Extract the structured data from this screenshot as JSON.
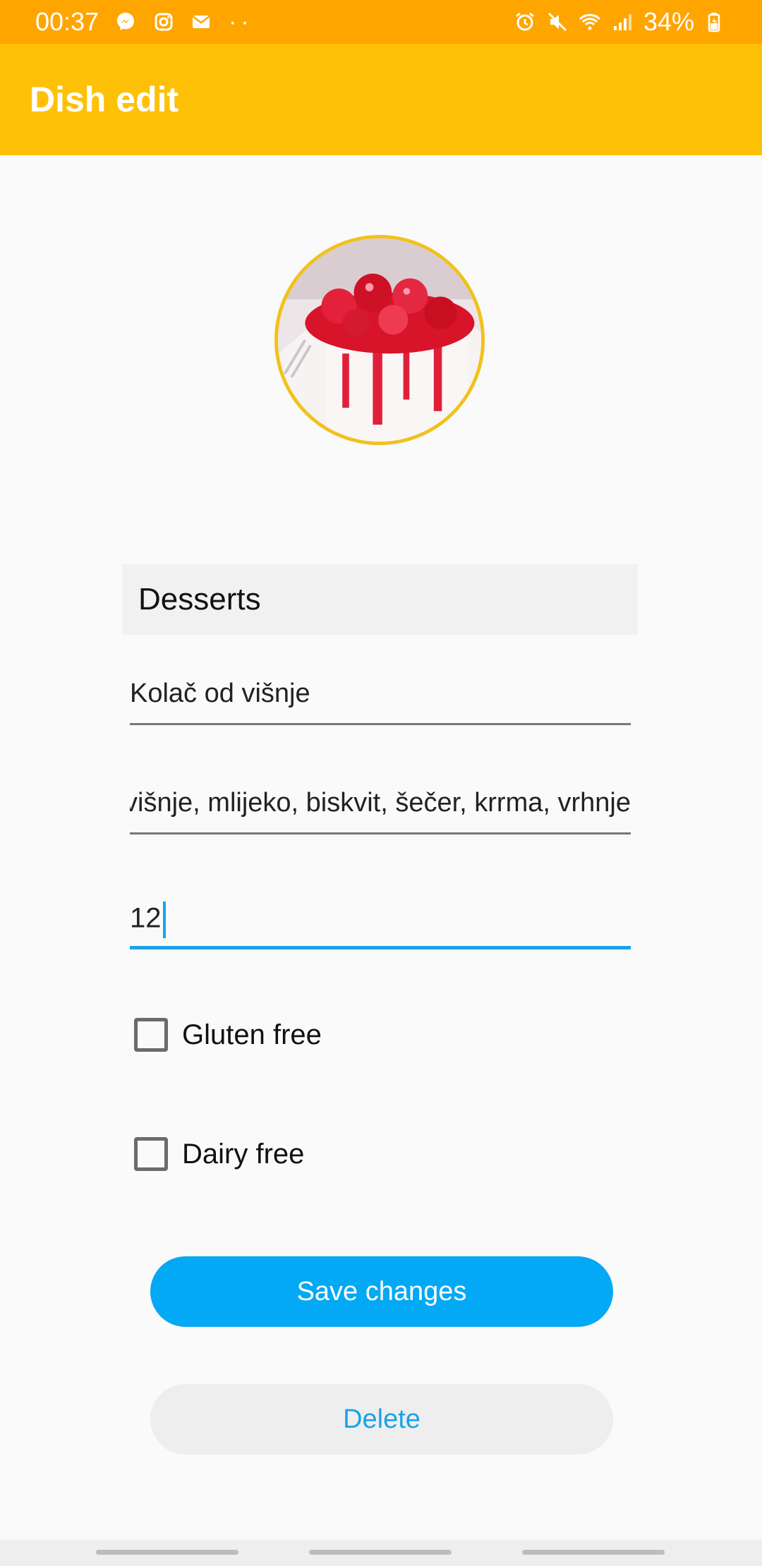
{
  "status_bar": {
    "time": "00:37",
    "dots": "··",
    "battery": "34%",
    "icons": [
      "messenger-icon",
      "instagram-icon",
      "mail-icon",
      "alarm-icon",
      "mute-icon",
      "wifi-icon",
      "signal-icon",
      "battery-icon"
    ]
  },
  "app_bar": {
    "title": "Dish edit"
  },
  "colors": {
    "status_bar": "#ffa500",
    "app_bar": "#ffc107",
    "accent": "#03a9f4",
    "photo_border": "#f2c11c"
  },
  "form": {
    "category": "Desserts",
    "name": "Kolač od višnje",
    "ingredients": "višnje, mlijeko, biskvit, šečer, krrma, vrhnje",
    "price": "12",
    "gluten_free": {
      "label": "Gluten free",
      "checked": false
    },
    "dairy_free": {
      "label": "Dairy free",
      "checked": false
    }
  },
  "buttons": {
    "save": "Save changes",
    "delete": "Delete"
  }
}
